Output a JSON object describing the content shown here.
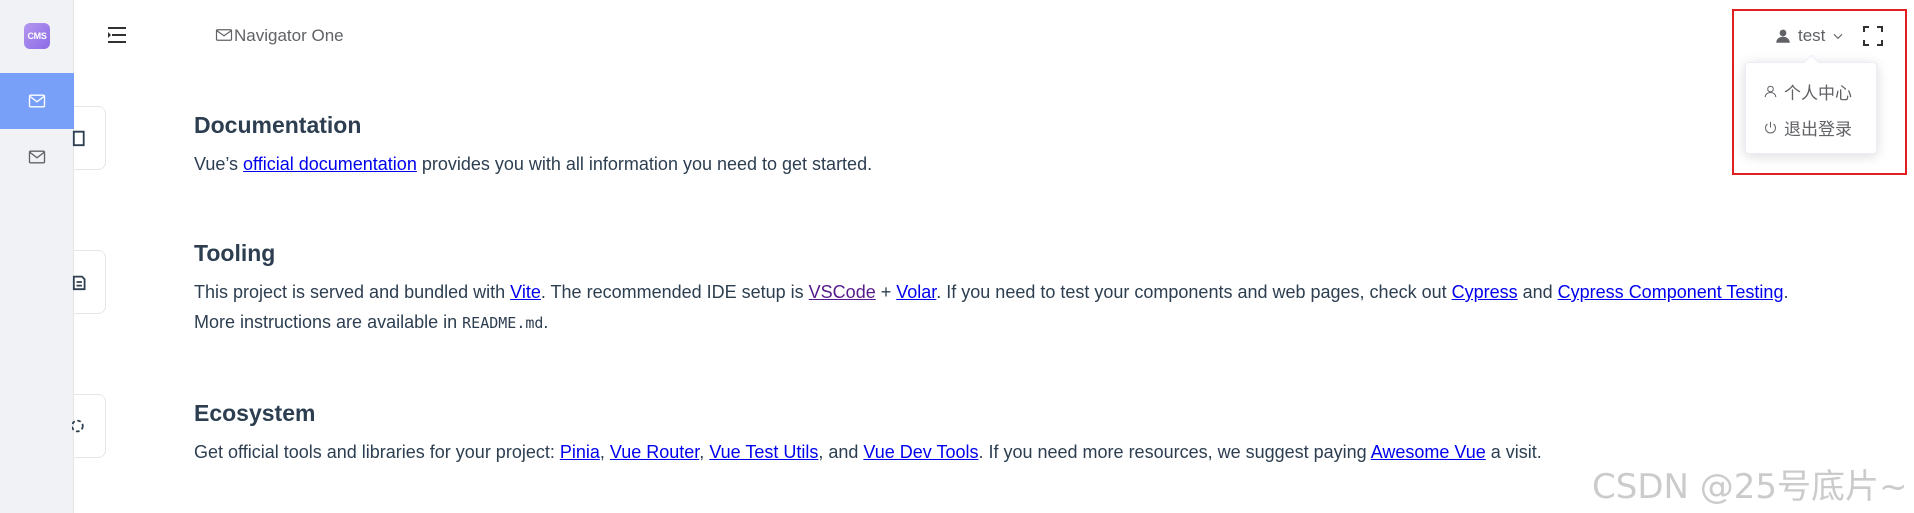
{
  "logo": {
    "text": "CMS"
  },
  "header": {
    "breadcrumb": "Navigator One",
    "user_name": "test"
  },
  "user_menu": {
    "items": [
      {
        "label": "个人中心",
        "icon": "user-icon"
      },
      {
        "label": "退出登录",
        "icon": "power-icon"
      }
    ]
  },
  "sections": {
    "documentation": {
      "title": "Documentation",
      "t1": "Vue’s ",
      "link1": "official documentation",
      "t2": " provides you with all information you need to get started."
    },
    "tooling": {
      "title": "Tooling",
      "t1": "This project is served and bundled with ",
      "link_vite": "Vite",
      "t2": ". The recommended IDE setup is ",
      "link_vscode": "VSCode",
      "t3": " + ",
      "link_volar": "Volar",
      "t4": ". If you need to test your components and web pages, check out ",
      "link_cypress": "Cypress",
      "t5": " and ",
      "link_cct": "Cypress Component Testing",
      "t6": ".",
      "t7": "More instructions are available in ",
      "code": "README.md",
      "t8": "."
    },
    "ecosystem": {
      "title": "Ecosystem",
      "t1": "Get official tools and libraries for your project: ",
      "link_pinia": "Pinia",
      "sep1": ", ",
      "link_router": "Vue Router",
      "sep2": ", ",
      "link_utils": "Vue Test Utils",
      "t2": ", and ",
      "link_devtools": "Vue Dev Tools",
      "t3": ". If you need more resources, we suggest paying ",
      "link_awesome": "Awesome Vue",
      "t4": " a visit."
    }
  },
  "watermark": "CSDN @25号底片~",
  "colors": {
    "active_menu": "#79a0f8",
    "link": "#0000ee",
    "visited_link": "#551a8b",
    "highlight_box": "#e02020"
  }
}
